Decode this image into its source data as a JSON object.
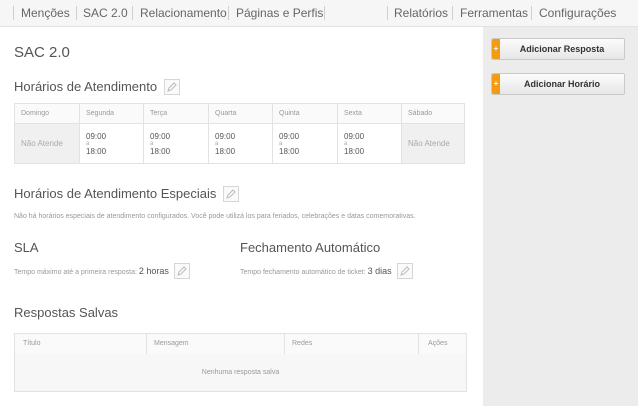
{
  "nav": {
    "left": [
      "Menções",
      "SAC 2.0",
      "Relacionamento",
      "Páginas e Perfis"
    ],
    "right": [
      "Relatórios",
      "Ferramentas",
      "Configurações"
    ]
  },
  "page_title": "SAC 2.0",
  "hours": {
    "title": "Horários de Atendimento",
    "days": [
      "Domingo",
      "Segunda",
      "Terça",
      "Quarta",
      "Quinta",
      "Sexta",
      "Sábado"
    ],
    "closed_label": "Não Atende",
    "open": "09:00",
    "to": "a",
    "close": "18:00"
  },
  "special": {
    "title": "Horários de Atendimento Especiais",
    "desc": "Não há horários especiais de atendimento configurados. Você pode utilizá los para feriados, celebrações e datas comemorativas."
  },
  "sla": {
    "title": "SLA",
    "desc": "Tempo máximo até a primeira resposta:",
    "value": "2 horas"
  },
  "closing": {
    "title": "Fechamento Automático",
    "desc": "Tempo fechamento automático de ticket:",
    "value": "3 dias"
  },
  "saved": {
    "title": "Respostas Salvas",
    "columns": [
      "Título",
      "Mensagem",
      "Redes",
      "Ações"
    ],
    "empty": "Nenhuma resposta salva"
  },
  "sidebar": {
    "add_response": "Adicionar Resposta",
    "add_hours": "Adicionar Horário",
    "plus": "+"
  },
  "colors": {
    "accent": "#f39c12"
  }
}
